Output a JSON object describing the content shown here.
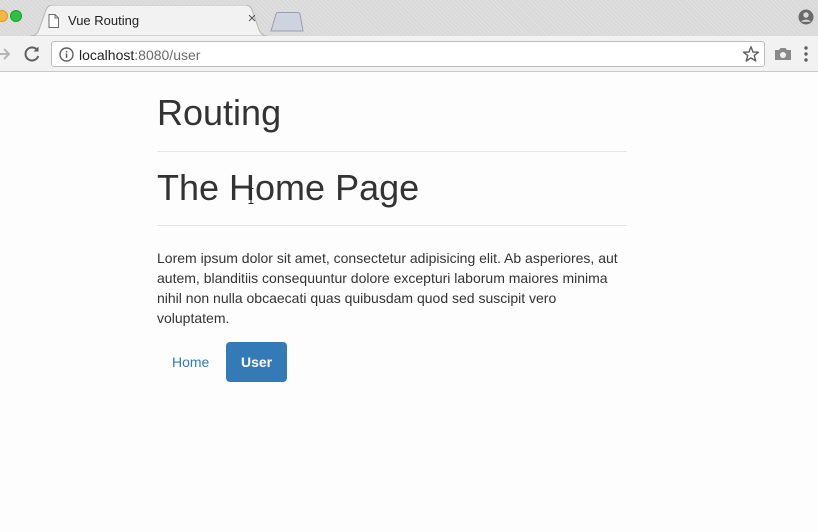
{
  "browser": {
    "tab_title": "Vue Routing",
    "tab_close": "×",
    "url_host": "localhost",
    "url_rest": ":8080/user",
    "icons": [
      "document-icon",
      "close-icon",
      "new-tab-icon",
      "profile-icon",
      "forward-icon",
      "reload-icon",
      "info-icon",
      "star-icon",
      "camera-icon",
      "menu-icon"
    ]
  },
  "page": {
    "site_title": "Routing",
    "heading": "The Home Page",
    "body_text": "Lorem ipsum dolor sit amet, consectetur adipisicing elit. Ab asperiores, aut autem, blanditiis consequuntur dolore excepturi laborum maiores minima nihil non nulla obcaecati quas quibusdam quod sed suscipit vero voluptatem.",
    "nav": {
      "home": "Home",
      "user": "User",
      "active": "User"
    }
  },
  "colors": {
    "link": "#337ab7",
    "active_bg": "#337ab7",
    "text": "#333333"
  }
}
